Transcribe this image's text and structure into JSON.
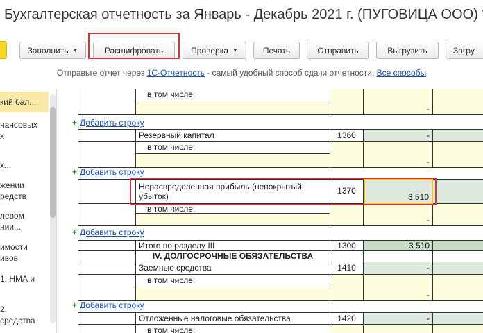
{
  "window": {
    "title": "Бухгалтерская отчетность за Январь - Декабрь 2021 г. (ПУГОВИЦА ООО) *"
  },
  "toolbar": {
    "fill_label": "Заполнить",
    "decode_label": "Расшифровать",
    "check_label": "Проверка",
    "print_label": "Печать",
    "send_label": "Отправить",
    "export_label": "Выгрузить",
    "import_label": "Загру"
  },
  "infobar": {
    "prefix": "Отправьте отчет через ",
    "link": "1С-Отчетность",
    "middle": " - самый удобный способ сдачи отчетности. ",
    "all_ways": "Все способы"
  },
  "sidebar": {
    "items": [
      {
        "label": "кий бал..."
      },
      {
        "label": "нансовых"
      },
      {
        "label": "х"
      },
      {
        "label": "х..."
      },
      {
        "label": "жении"
      },
      {
        "label": "редств"
      },
      {
        "label": "левом"
      },
      {
        "label": "нии..."
      },
      {
        "label": "имости"
      },
      {
        "label": "ивов"
      },
      {
        "label": "1. НМА и"
      },
      {
        "label": "2."
      },
      {
        "label": "средства"
      }
    ]
  },
  "report": {
    "add_row_label": "Добавить строку",
    "incl_label": "в том числе:",
    "dash": "-",
    "rows": {
      "reserve_capital": {
        "name": "Резервный капитал",
        "code": "1360"
      },
      "retained_earnings": {
        "name": "Нераспределенная прибыль (непокрытый убыток)",
        "code": "1370",
        "value": "3 510"
      },
      "total_section3": {
        "name": "Итого по разделу III",
        "code": "1300",
        "value": "3 510"
      },
      "section4_header": "IV. ДОЛГОСРОЧНЫЕ ОБЯЗАТЕЛЬСТВА",
      "borrowed_funds": {
        "name": "Заемные средства",
        "code": "1410"
      },
      "deferred_tax": {
        "name": "Отложенные налоговые обязательства",
        "code": "1420"
      }
    }
  },
  "colors": {
    "highlight": "#d2343a",
    "link": "#1c4fa5",
    "selected_cell": "#f1c232"
  }
}
